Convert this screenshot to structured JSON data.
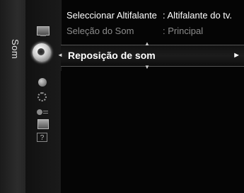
{
  "category": {
    "label": "Som"
  },
  "icons": [
    "tv-icon",
    "sound-icon",
    "channel-icon",
    "setup-icon",
    "input-icon",
    "application-icon",
    "support-icon"
  ],
  "menu": {
    "items": [
      {
        "label": "Seleccionar Altifalante",
        "value": ": Altifalante do tv."
      },
      {
        "label": "Seleção do Som",
        "value": ": Principal"
      }
    ],
    "selected": {
      "label": "Reposição de som",
      "arrow": "►"
    }
  },
  "help_icon_glyph": "?"
}
